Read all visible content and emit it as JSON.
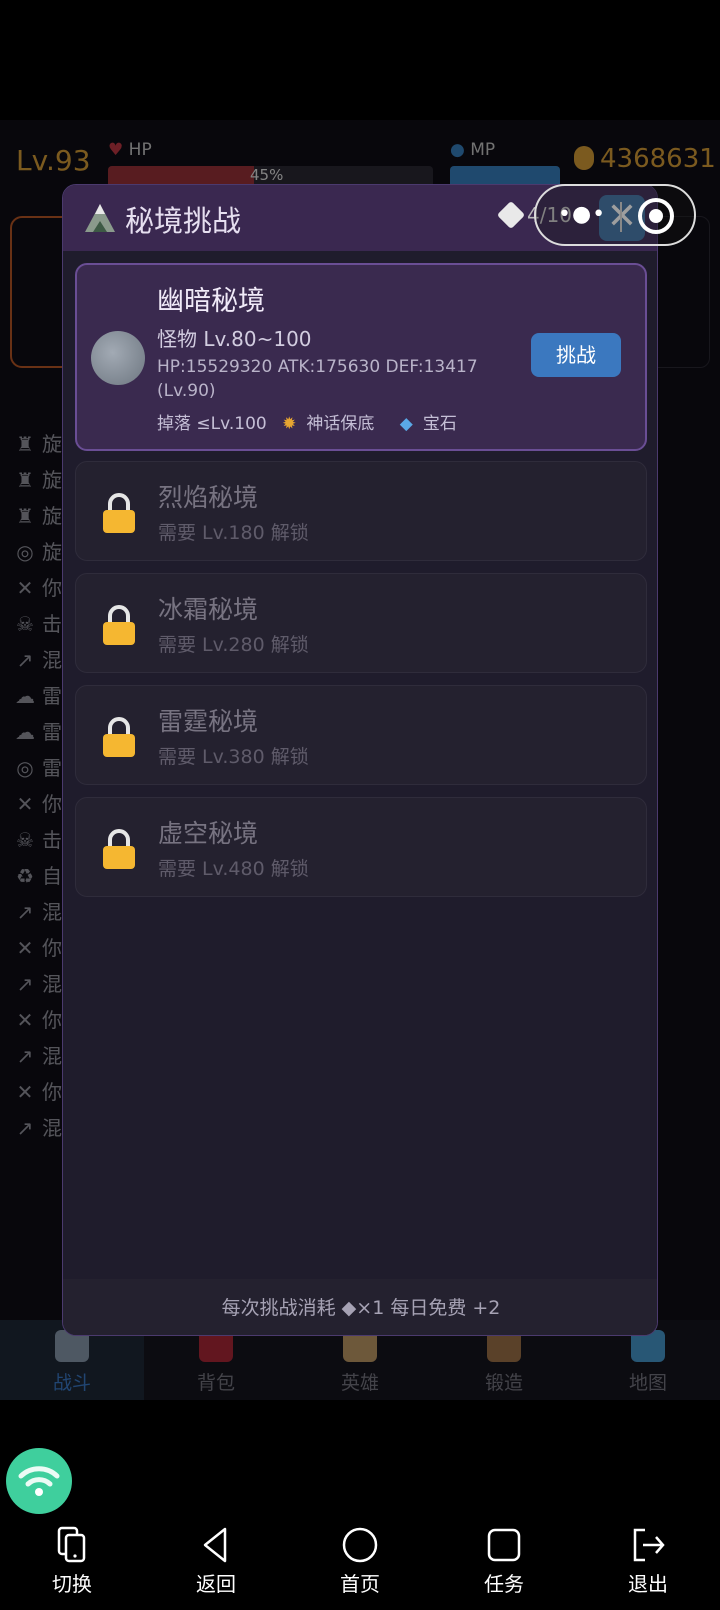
{
  "background": {
    "level": "Lv.93",
    "hp_label": "HP",
    "hp_percent_text": "45%",
    "hp_fill": 0.45,
    "mp_label": "MP",
    "gold": "4368631",
    "log_rows": [
      {
        "icon": "trophy-icon",
        "text": "旋"
      },
      {
        "icon": "trophy-icon",
        "text": "旋"
      },
      {
        "icon": "trophy-icon",
        "text": "旋"
      },
      {
        "icon": "swirl-icon",
        "text": "旋"
      },
      {
        "icon": "swords-icon",
        "text": "你"
      },
      {
        "icon": "skull-icon",
        "text": "击"
      },
      {
        "icon": "dagger-icon",
        "text": "混"
      },
      {
        "icon": "storm-icon",
        "text": "雷"
      },
      {
        "icon": "storm-icon",
        "text": "雷"
      },
      {
        "icon": "swirl-icon",
        "text": "雷"
      },
      {
        "icon": "swords-icon",
        "text": "你"
      },
      {
        "icon": "skull-icon",
        "text": "击"
      },
      {
        "icon": "recycle-icon",
        "text": "自"
      },
      {
        "icon": "dagger-icon",
        "text": "混"
      },
      {
        "icon": "swords-icon",
        "text": "你"
      },
      {
        "icon": "dagger-icon",
        "text": "混"
      },
      {
        "icon": "swords-icon",
        "text": "你"
      },
      {
        "icon": "dagger-icon",
        "text": "混"
      },
      {
        "icon": "swords-icon",
        "text": "你"
      },
      {
        "icon": "dagger-icon",
        "text": "混"
      }
    ],
    "nav": [
      {
        "label": "战斗",
        "icon": "sword-icon",
        "active": true
      },
      {
        "label": "背包",
        "icon": "bag-icon",
        "active": false
      },
      {
        "label": "英雄",
        "icon": "hero-icon",
        "active": false
      },
      {
        "label": "锻造",
        "icon": "hammer-icon",
        "active": false
      },
      {
        "label": "地图",
        "icon": "map-icon",
        "active": false
      }
    ]
  },
  "modal": {
    "title": "秘境挑战",
    "ticket_count": "4/10",
    "close_symbol": "✕",
    "realms": [
      {
        "name": "幽暗秘境",
        "monster": "怪物 Lv.80~100",
        "stats": "HP:15529320 ATK:175630 DEF:13417 (Lv.90)",
        "drop_label": "掉落 ≤Lv.100",
        "drop_myth": "神话保底",
        "drop_gem": "宝石",
        "button": "挑战"
      },
      {
        "name": "烈焰秘境",
        "requirement": "需要 Lv.180 解锁"
      },
      {
        "name": "冰霜秘境",
        "requirement": "需要 Lv.280 解锁"
      },
      {
        "name": "雷霆秘境",
        "requirement": "需要 Lv.380 解锁"
      },
      {
        "name": "虚空秘境",
        "requirement": "需要 Lv.480 解锁"
      }
    ],
    "footer": "每次挑战消耗 ◆×1  每日免费 +2"
  },
  "system_bar": [
    {
      "label": "切换",
      "icon": "switch-icon"
    },
    {
      "label": "返回",
      "icon": "back-icon"
    },
    {
      "label": "首页",
      "icon": "home-icon"
    },
    {
      "label": "任务",
      "icon": "tasks-icon"
    },
    {
      "label": "退出",
      "icon": "exit-icon"
    }
  ],
  "colors": {
    "accent": "#3b78bf",
    "gold": "#e0a53a",
    "header": "#3a2850",
    "lock": "#f5b731"
  }
}
